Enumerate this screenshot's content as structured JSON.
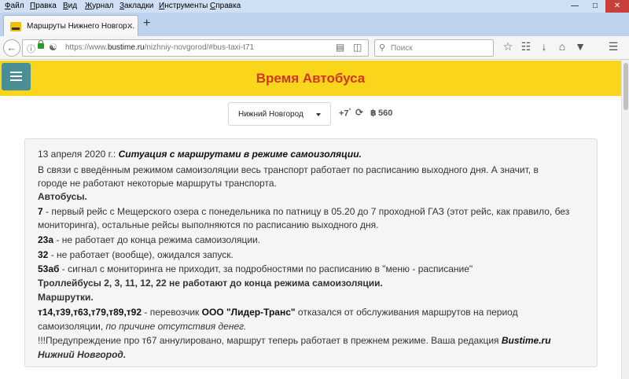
{
  "browser": {
    "menu": [
      "Файл",
      "Правка",
      "Вид",
      "Журнал",
      "Закладки",
      "Инструменты",
      "Справка"
    ],
    "window_controls": {
      "minimize": "—",
      "maximize": "□",
      "close": "✕"
    },
    "tab": {
      "title": "Маршруты Нижнего Новгор…",
      "close": "×"
    },
    "new_tab": "+",
    "url": {
      "prefix": "https://www.",
      "domain": "bustime.ru",
      "path": "/nizhniy-novgorod/#bus-taxi-t71"
    },
    "search_placeholder": "Поиск",
    "icons": [
      "back-icon",
      "info-icon",
      "lock-icon",
      "reader-icon",
      "bookmark-star-icon",
      "library-icon",
      "download-icon",
      "home-icon",
      "pocket-icon",
      "hamburger-icon"
    ]
  },
  "header": {
    "title": "Время Автобуса"
  },
  "controls": {
    "city": "Нижний Новгород",
    "timezone": "+7",
    "timezone_sup": "°",
    "coins": "560"
  },
  "notice": {
    "date": "13 апреля 2020 г.:",
    "headline": "Ситуация с маршрутами в режиме самоизоляции.",
    "intro_1": "В связи с введённым режимом самоизоляции весь транспорт работает по расписанию выходного дня. А значит, в",
    "intro_2": "городе не работают некоторые маршруты транспорта.",
    "buses_heading": "Автобусы.",
    "r7_num": "7",
    "r7_text_1": " - первый рейс с Мещерского озера с понедельника по патницу в 05.20 до 7 проходной ГАЗ (этот рейс, как правило, без",
    "r7_text_2": "мониторинга), остальные рейсы выполняются по расписанию выходного дня.",
    "r23_num": "23а",
    "r23_text": " - не работает до конца режима самоизоляции.",
    "r32_num": "32",
    "r32_text": " - не работает (вообще), ожидался запуск.",
    "r53_num": "53аб",
    "r53_text": " - сигнал с мониторинга не приходит, за подробностями по расписанию в \"меню - расписание\"",
    "trolley": "Троллейбусы 2, 3, 11, 12, 22 не работают до конца режима самоизоляции.",
    "minibus_heading": "Маршрутки.",
    "minibus_routes": "т14,т39,т63,т79,т89,т92",
    "minibus_text_a": " - перевозчик ",
    "minibus_company": "ООО \"Лидер-Транс\"",
    "minibus_text_b": " отказался от обслуживания маршрутов на период",
    "minibus_text_c": "самоизоляции, ",
    "minibus_reason": "по причине отсутствия денег.",
    "warning": "!!!Предупреждение про т67 аннулировано, маршрут теперь работает в прежнем режиме. Ваша редакция ",
    "signature_1": "Bustime.ru",
    "signature_2": "Нижний Новгород."
  },
  "colors": {
    "header_bg": "#f9d61b",
    "title_red": "#d2371d",
    "menu_btn": "#4a8e96"
  }
}
